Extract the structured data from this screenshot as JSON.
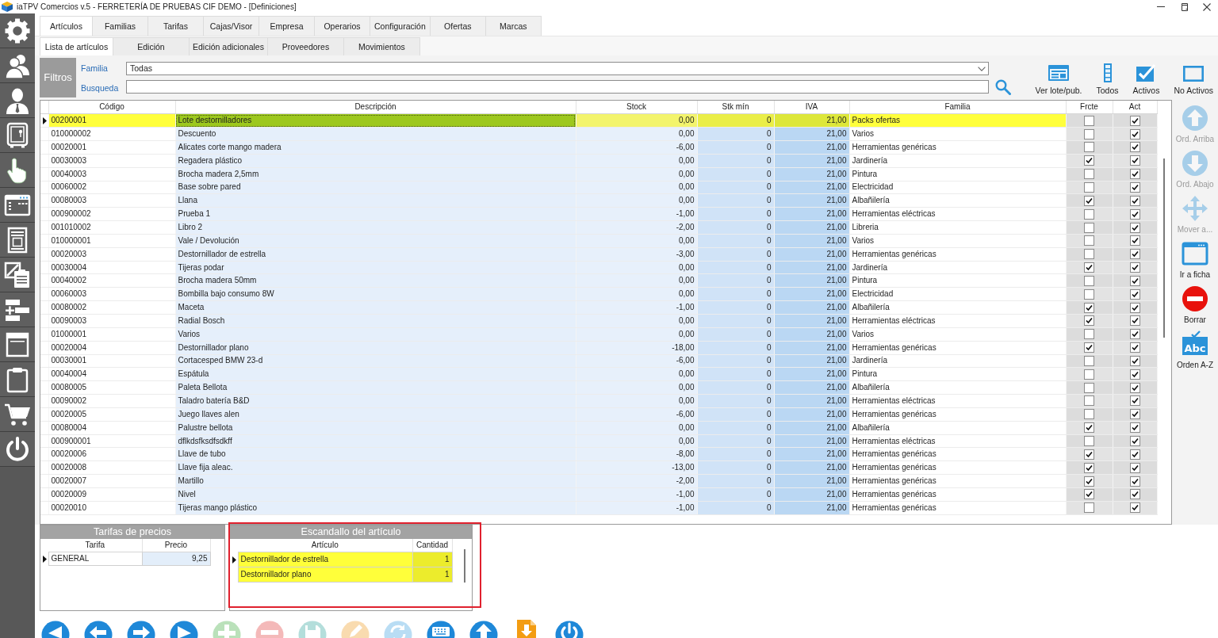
{
  "window": {
    "title": "iaTPV Comercios v.5 - FERRETERÍA DE PRUEBAS CIF DEMO - [Definiciones]"
  },
  "tabs": [
    {
      "label": "Artículos",
      "selected": true
    },
    {
      "label": "Familias",
      "selected": false
    },
    {
      "label": "Tarifas",
      "selected": false
    },
    {
      "label": "Cajas/Visor",
      "selected": false
    },
    {
      "label": "Empresa",
      "selected": false
    },
    {
      "label": "Operarios",
      "selected": false
    },
    {
      "label": "Configuración",
      "selected": false
    },
    {
      "label": "Ofertas",
      "selected": false
    },
    {
      "label": "Marcas",
      "selected": false
    }
  ],
  "subtabs": [
    {
      "label": "Lista de artículos",
      "selected": true
    },
    {
      "label": "Edición",
      "selected": false
    },
    {
      "label": "Edición adicionales",
      "selected": false
    },
    {
      "label": "Proveedores",
      "selected": false
    },
    {
      "label": "Movimientos",
      "selected": false
    }
  ],
  "filters": {
    "title": "Filtros",
    "fields": [
      {
        "label": "Familia",
        "kind": "dropdown",
        "value": "Todas"
      },
      {
        "label": "Busqueda",
        "kind": "text"
      }
    ]
  },
  "toolbar": [
    {
      "label": "Ver lote/pub."
    },
    {
      "label": "Todos"
    },
    {
      "label": "Activos"
    },
    {
      "label": "No Activos"
    }
  ],
  "table": {
    "columns": [
      {
        "label": "Código",
        "kind": "text"
      },
      {
        "label": "Descripción",
        "kind": "text"
      },
      {
        "label": "Stock",
        "kind": "number"
      },
      {
        "label": "Stk mín",
        "kind": "number"
      },
      {
        "label": "IVA",
        "kind": "number"
      },
      {
        "label": "Familia",
        "kind": "text"
      },
      {
        "label": "Frcte",
        "kind": "check"
      },
      {
        "label": "Act",
        "kind": "check"
      }
    ],
    "rows": [
      {
        "selected": true,
        "cells": [
          "00200001",
          "Lote destornilladores",
          "0,00",
          "0",
          "21,00",
          "Packs ofertas"
        ],
        "checks": [
          {
            "checked": false
          },
          {
            "checked": true
          }
        ]
      },
      {
        "selected": false,
        "cells": [
          "010000002",
          "Descuento",
          "0,00",
          "0",
          "21,00",
          "Varios"
        ],
        "checks": [
          {
            "checked": false
          },
          {
            "checked": true
          }
        ]
      },
      {
        "selected": false,
        "cells": [
          "00020001",
          "Alicates corte mango madera",
          "-6,00",
          "0",
          "21,00",
          "Herramientas genéricas"
        ],
        "checks": [
          {
            "checked": false
          },
          {
            "checked": true
          }
        ]
      },
      {
        "selected": false,
        "cells": [
          "00030003",
          "Regadera plástico",
          "0,00",
          "0",
          "21,00",
          "Jardinería"
        ],
        "checks": [
          {
            "checked": true
          },
          {
            "checked": true
          }
        ]
      },
      {
        "selected": false,
        "cells": [
          "00040003",
          "Brocha madera 2,5mm",
          "0,00",
          "0",
          "21,00",
          "Pintura"
        ],
        "checks": [
          {
            "checked": false
          },
          {
            "checked": true
          }
        ]
      },
      {
        "selected": false,
        "cells": [
          "00060002",
          "Base sobre pared",
          "0,00",
          "0",
          "21,00",
          "Electricidad"
        ],
        "checks": [
          {
            "checked": false
          },
          {
            "checked": true
          }
        ]
      },
      {
        "selected": false,
        "cells": [
          "00080003",
          "Llana",
          "0,00",
          "0",
          "21,00",
          "Albañilería"
        ],
        "checks": [
          {
            "checked": true
          },
          {
            "checked": true
          }
        ]
      },
      {
        "selected": false,
        "cells": [
          "000900002",
          "Prueba 1",
          "-1,00",
          "0",
          "21,00",
          "Herramientas eléctricas"
        ],
        "checks": [
          {
            "checked": false
          },
          {
            "checked": true
          }
        ]
      },
      {
        "selected": false,
        "cells": [
          "001010002",
          "Libro 2",
          "-2,00",
          "0",
          "21,00",
          "Libreria"
        ],
        "checks": [
          {
            "checked": false
          },
          {
            "checked": true
          }
        ]
      },
      {
        "selected": false,
        "cells": [
          "010000001",
          "Vale / Devolución",
          "0,00",
          "0",
          "21,00",
          "Varios"
        ],
        "checks": [
          {
            "checked": false
          },
          {
            "checked": true
          }
        ]
      },
      {
        "selected": false,
        "cells": [
          "00020003",
          "Destornillador de estrella",
          "-3,00",
          "0",
          "21,00",
          "Herramientas genéricas"
        ],
        "checks": [
          {
            "checked": false
          },
          {
            "checked": true
          }
        ]
      },
      {
        "selected": false,
        "cells": [
          "00030004",
          "Tijeras podar",
          "0,00",
          "0",
          "21,00",
          "Jardinería"
        ],
        "checks": [
          {
            "checked": true
          },
          {
            "checked": true
          }
        ]
      },
      {
        "selected": false,
        "cells": [
          "00040002",
          "Brocha madera 50mm",
          "0,00",
          "0",
          "21,00",
          "Pintura"
        ],
        "checks": [
          {
            "checked": false
          },
          {
            "checked": true
          }
        ]
      },
      {
        "selected": false,
        "cells": [
          "00060003",
          "Bombilla bajo consumo 8W",
          "0,00",
          "0",
          "21,00",
          "Electricidad"
        ],
        "checks": [
          {
            "checked": false
          },
          {
            "checked": true
          }
        ]
      },
      {
        "selected": false,
        "cells": [
          "00080002",
          "Maceta",
          "-1,00",
          "0",
          "21,00",
          "Albañilería"
        ],
        "checks": [
          {
            "checked": true
          },
          {
            "checked": true
          }
        ]
      },
      {
        "selected": false,
        "cells": [
          "00090003",
          "Radial Bosch",
          "0,00",
          "0",
          "21,00",
          "Herramientas eléctricas"
        ],
        "checks": [
          {
            "checked": true
          },
          {
            "checked": true
          }
        ]
      },
      {
        "selected": false,
        "cells": [
          "01000001",
          "Varios",
          "0,00",
          "0",
          "21,00",
          "Varios"
        ],
        "checks": [
          {
            "checked": false
          },
          {
            "checked": true
          }
        ]
      },
      {
        "selected": false,
        "cells": [
          "00020004",
          "Destornillador plano",
          "-18,00",
          "0",
          "21,00",
          "Herramientas genéricas"
        ],
        "checks": [
          {
            "checked": true
          },
          {
            "checked": true
          }
        ]
      },
      {
        "selected": false,
        "cells": [
          "00030001",
          "Cortacesped BMW 23-d",
          "-6,00",
          "0",
          "21,00",
          "Jardinería"
        ],
        "checks": [
          {
            "checked": false
          },
          {
            "checked": true
          }
        ]
      },
      {
        "selected": false,
        "cells": [
          "00040004",
          "Espátula",
          "0,00",
          "0",
          "21,00",
          "Pintura"
        ],
        "checks": [
          {
            "checked": false
          },
          {
            "checked": true
          }
        ]
      },
      {
        "selected": false,
        "cells": [
          "00080005",
          "Paleta Bellota",
          "0,00",
          "0",
          "21,00",
          "Albañilería"
        ],
        "checks": [
          {
            "checked": false
          },
          {
            "checked": true
          }
        ]
      },
      {
        "selected": false,
        "cells": [
          "00090002",
          "Taladro batería B&D",
          "0,00",
          "0",
          "21,00",
          "Herramientas eléctricas"
        ],
        "checks": [
          {
            "checked": false
          },
          {
            "checked": true
          }
        ]
      },
      {
        "selected": false,
        "cells": [
          "00020005",
          "Juego llaves alen",
          "-6,00",
          "0",
          "21,00",
          "Herramientas genéricas"
        ],
        "checks": [
          {
            "checked": false
          },
          {
            "checked": true
          }
        ]
      },
      {
        "selected": false,
        "cells": [
          "00080004",
          "Palustre bellota",
          "0,00",
          "0",
          "21,00",
          "Albañilería"
        ],
        "checks": [
          {
            "checked": true
          },
          {
            "checked": true
          }
        ]
      },
      {
        "selected": false,
        "cells": [
          "000900001",
          "dflkdsfksdfsdkff",
          "0,00",
          "0",
          "21,00",
          "Herramientas eléctricas"
        ],
        "checks": [
          {
            "checked": false
          },
          {
            "checked": true
          }
        ]
      },
      {
        "selected": false,
        "cells": [
          "00020006",
          "Llave de tubo",
          "-8,00",
          "0",
          "21,00",
          "Herramientas genéricas"
        ],
        "checks": [
          {
            "checked": true
          },
          {
            "checked": true
          }
        ]
      },
      {
        "selected": false,
        "cells": [
          "00020008",
          "Llave fija aleac.",
          "-13,00",
          "0",
          "21,00",
          "Herramientas genéricas"
        ],
        "checks": [
          {
            "checked": true
          },
          {
            "checked": true
          }
        ]
      },
      {
        "selected": false,
        "cells": [
          "00020007",
          "Martillo",
          "-2,00",
          "0",
          "21,00",
          "Herramientas genéricas"
        ],
        "checks": [
          {
            "checked": true
          },
          {
            "checked": true
          }
        ]
      },
      {
        "selected": false,
        "cells": [
          "00020009",
          "Nivel",
          "-1,00",
          "0",
          "21,00",
          "Herramientas genéricas"
        ],
        "checks": [
          {
            "checked": true
          },
          {
            "checked": true
          }
        ]
      },
      {
        "selected": false,
        "cells": [
          "00020010",
          "Tijeras mango plástico",
          "-1,00",
          "0",
          "21,00",
          "Herramientas genéricas"
        ],
        "checks": [
          {
            "checked": false
          },
          {
            "checked": true
          }
        ]
      }
    ]
  },
  "side_actions": [
    {
      "label": "Ord. Arriba",
      "disabled": true
    },
    {
      "label": "Ord. Abajo",
      "disabled": true
    },
    {
      "label": "Mover a...",
      "disabled": true
    },
    {
      "label": "Ir a ficha",
      "disabled": false
    },
    {
      "label": "Borrar",
      "disabled": false
    },
    {
      "label": "Orden A-Z",
      "disabled": false,
      "icon_text": "Abc"
    }
  ],
  "price_rates": {
    "title": "Tarifas de precios",
    "columns": [
      "Tarifa",
      "Precio"
    ],
    "rows": [
      {
        "selected": true,
        "cells": [
          "GENERAL",
          "9,25"
        ]
      }
    ]
  },
  "breakdown": {
    "title": "Escandallo del artículo",
    "highlighted": true,
    "columns": [
      "Artículo",
      "Cantidad"
    ],
    "rows": [
      {
        "selected": true,
        "cells": [
          "Destornillador de estrella",
          "1"
        ]
      },
      {
        "selected": false,
        "cells": [
          "Destornillador plano",
          "1"
        ]
      }
    ]
  },
  "bottom_toolbar": [
    {
      "disabled": false
    },
    {
      "disabled": false
    },
    {
      "disabled": false
    },
    {
      "disabled": false
    },
    {
      "disabled": true
    },
    {
      "disabled": true
    },
    {
      "disabled": true
    },
    {
      "disabled": true
    },
    {
      "disabled": true
    },
    {
      "disabled": false
    },
    {
      "disabled": false
    },
    {
      "disabled": false
    },
    {
      "disabled": false
    }
  ]
}
